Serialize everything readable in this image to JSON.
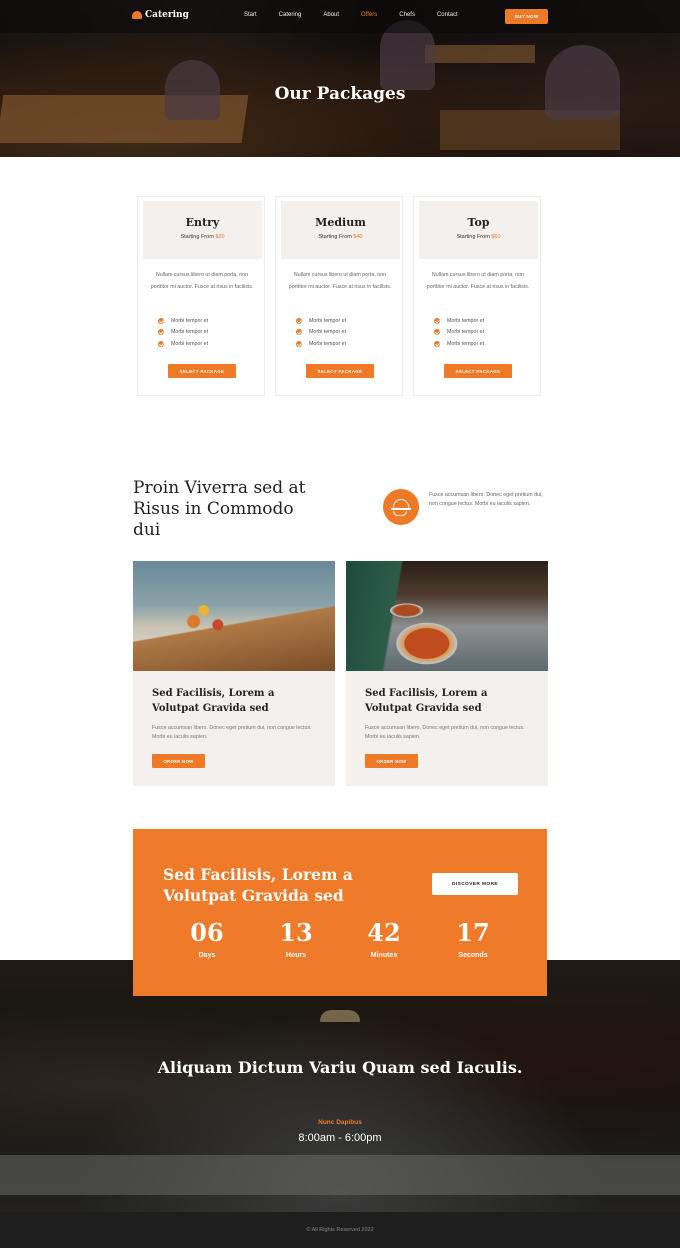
{
  "header": {
    "logo_text": "Catering",
    "nav": [
      "Start",
      "Catering",
      "About",
      "Offers",
      "Chefs",
      "Contact"
    ],
    "active_nav": "Offers",
    "buy_button": "BUY NOW",
    "hero_title": "Our Packages"
  },
  "packages": [
    {
      "name": "Entry",
      "starting_from_label": "Starting From",
      "price": "$20",
      "description": "Nullam cursus libero ut diam porta, non porttitor mi auctor. Fusce at risus in facilisis.",
      "features": [
        "Morbi tempor et",
        "Morbi tempor et",
        "Morbi tempor et"
      ],
      "button": "SELECT PACKAGE"
    },
    {
      "name": "Medium",
      "starting_from_label": "Starting From",
      "price": "$40",
      "description": "Nullam cursus libero ut diam porta, non porttitor mi auctor. Fusce at risus in facilisis.",
      "features": [
        "Morbi tempor et",
        "Morbi tempor et",
        "Morbi tempor et"
      ],
      "button": "SELECT PACKAGE"
    },
    {
      "name": "Top",
      "starting_from_label": "Starting From",
      "price": "$60",
      "description": "Nullam cursus libero ut diam porta, non porttitor mi auctor. Fusce at risus in facilisis.",
      "features": [
        "Morbi tempor et",
        "Morbi tempor et",
        "Morbi tempor et"
      ],
      "button": "SELECT PACKAGE"
    }
  ],
  "section2": {
    "title": "Proin Viverra sed at Risus in Commodo dui",
    "icon": "serving-cloche-icon",
    "text": "Fusce accumsan libero. Donec eget pretium dui, non congue lectus. Morbi eu iaculis sapien."
  },
  "cards": [
    {
      "title": "Sed Facilisis, Lorem a Volutpat Gravida sed",
      "text": "Fusce accumsan libero. Donec eget pretium dui, non congue lectus. Morbi eu iaculis sapien.",
      "button": "ORDER NOW"
    },
    {
      "title": "Sed Facilisis, Lorem a Volutpat Gravida sed",
      "text": "Fusce accumsan libero. Donec eget pretium dui, non congue lectus. Morbi eu iaculis sapien.",
      "button": "ORDER NOW"
    }
  ],
  "cta": {
    "title": "Sed Facilisis, Lorem a Volutpat Gravida sed",
    "button": "DISCOVER MORE",
    "countdown": [
      {
        "value": "06",
        "label": "Days"
      },
      {
        "value": "13",
        "label": "Hours"
      },
      {
        "value": "42",
        "label": "Minutes"
      },
      {
        "value": "17",
        "label": "Seconds"
      }
    ]
  },
  "hours": {
    "title": "Aliquam Dictum Variu Quam sed Iaculis.",
    "label": "Nunc Dapibus",
    "time": "8:00am - 6:00pm"
  },
  "footer": {
    "copyright": "© All Rights Reserved 2022"
  },
  "colors": {
    "accent": "#ee7a27",
    "card_bg": "#f4f0ed",
    "footer_bg": "#1e1e1e"
  }
}
